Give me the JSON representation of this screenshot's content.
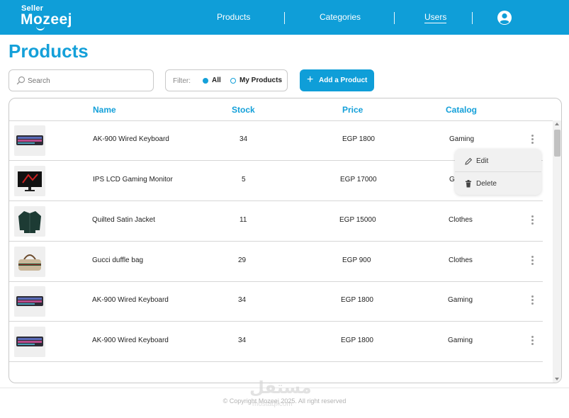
{
  "brand": {
    "small": "Seller",
    "name": "Mozeej"
  },
  "nav": {
    "items": [
      {
        "label": "Products"
      },
      {
        "label": "Categories"
      },
      {
        "label": "Users"
      }
    ]
  },
  "page": {
    "title": "Products"
  },
  "search": {
    "placeholder": "Search"
  },
  "filter": {
    "label": "Filter:",
    "options": [
      {
        "label": "All",
        "selected": true
      },
      {
        "label": "My Products",
        "selected": false
      }
    ]
  },
  "actions": {
    "add_label": "Add a Product"
  },
  "table": {
    "headers": {
      "name": "Name",
      "stock": "Stock",
      "price": "Price",
      "catalog": "Catalog"
    },
    "rows": [
      {
        "image": "keyboard-image",
        "name": "AK-900 Wired Keyboard",
        "stock": "34",
        "price": "EGP 1800",
        "catalog": "Gaming"
      },
      {
        "image": "monitor-image",
        "name": "IPS LCD Gaming Monitor",
        "stock": "5",
        "price": "EGP 17000",
        "catalog": "G"
      },
      {
        "image": "jacket-image",
        "name": "Quilted Satin Jacket",
        "stock": "11",
        "price": "EGP 15000",
        "catalog": "Clothes"
      },
      {
        "image": "bag-image",
        "name": "Gucci duffle bag",
        "stock": "29",
        "price": "EGP 900",
        "catalog": "Clothes"
      },
      {
        "image": "keyboard-image",
        "name": "AK-900 Wired Keyboard",
        "stock": "34",
        "price": "EGP 1800",
        "catalog": "Gaming"
      },
      {
        "image": "keyboard-image",
        "name": "AK-900 Wired Keyboard",
        "stock": "34",
        "price": "EGP 1800",
        "catalog": "Gaming"
      }
    ]
  },
  "row_menu": {
    "edit": "Edit",
    "delete": "Delete"
  },
  "footer": {
    "copyright": "Copyright Mozeej 2025. All right reserved"
  },
  "watermark": {
    "text": "مستقل",
    "sub": "mostaql.com"
  },
  "colors": {
    "accent": "#0f9ed8",
    "title": "#14a0d9"
  }
}
